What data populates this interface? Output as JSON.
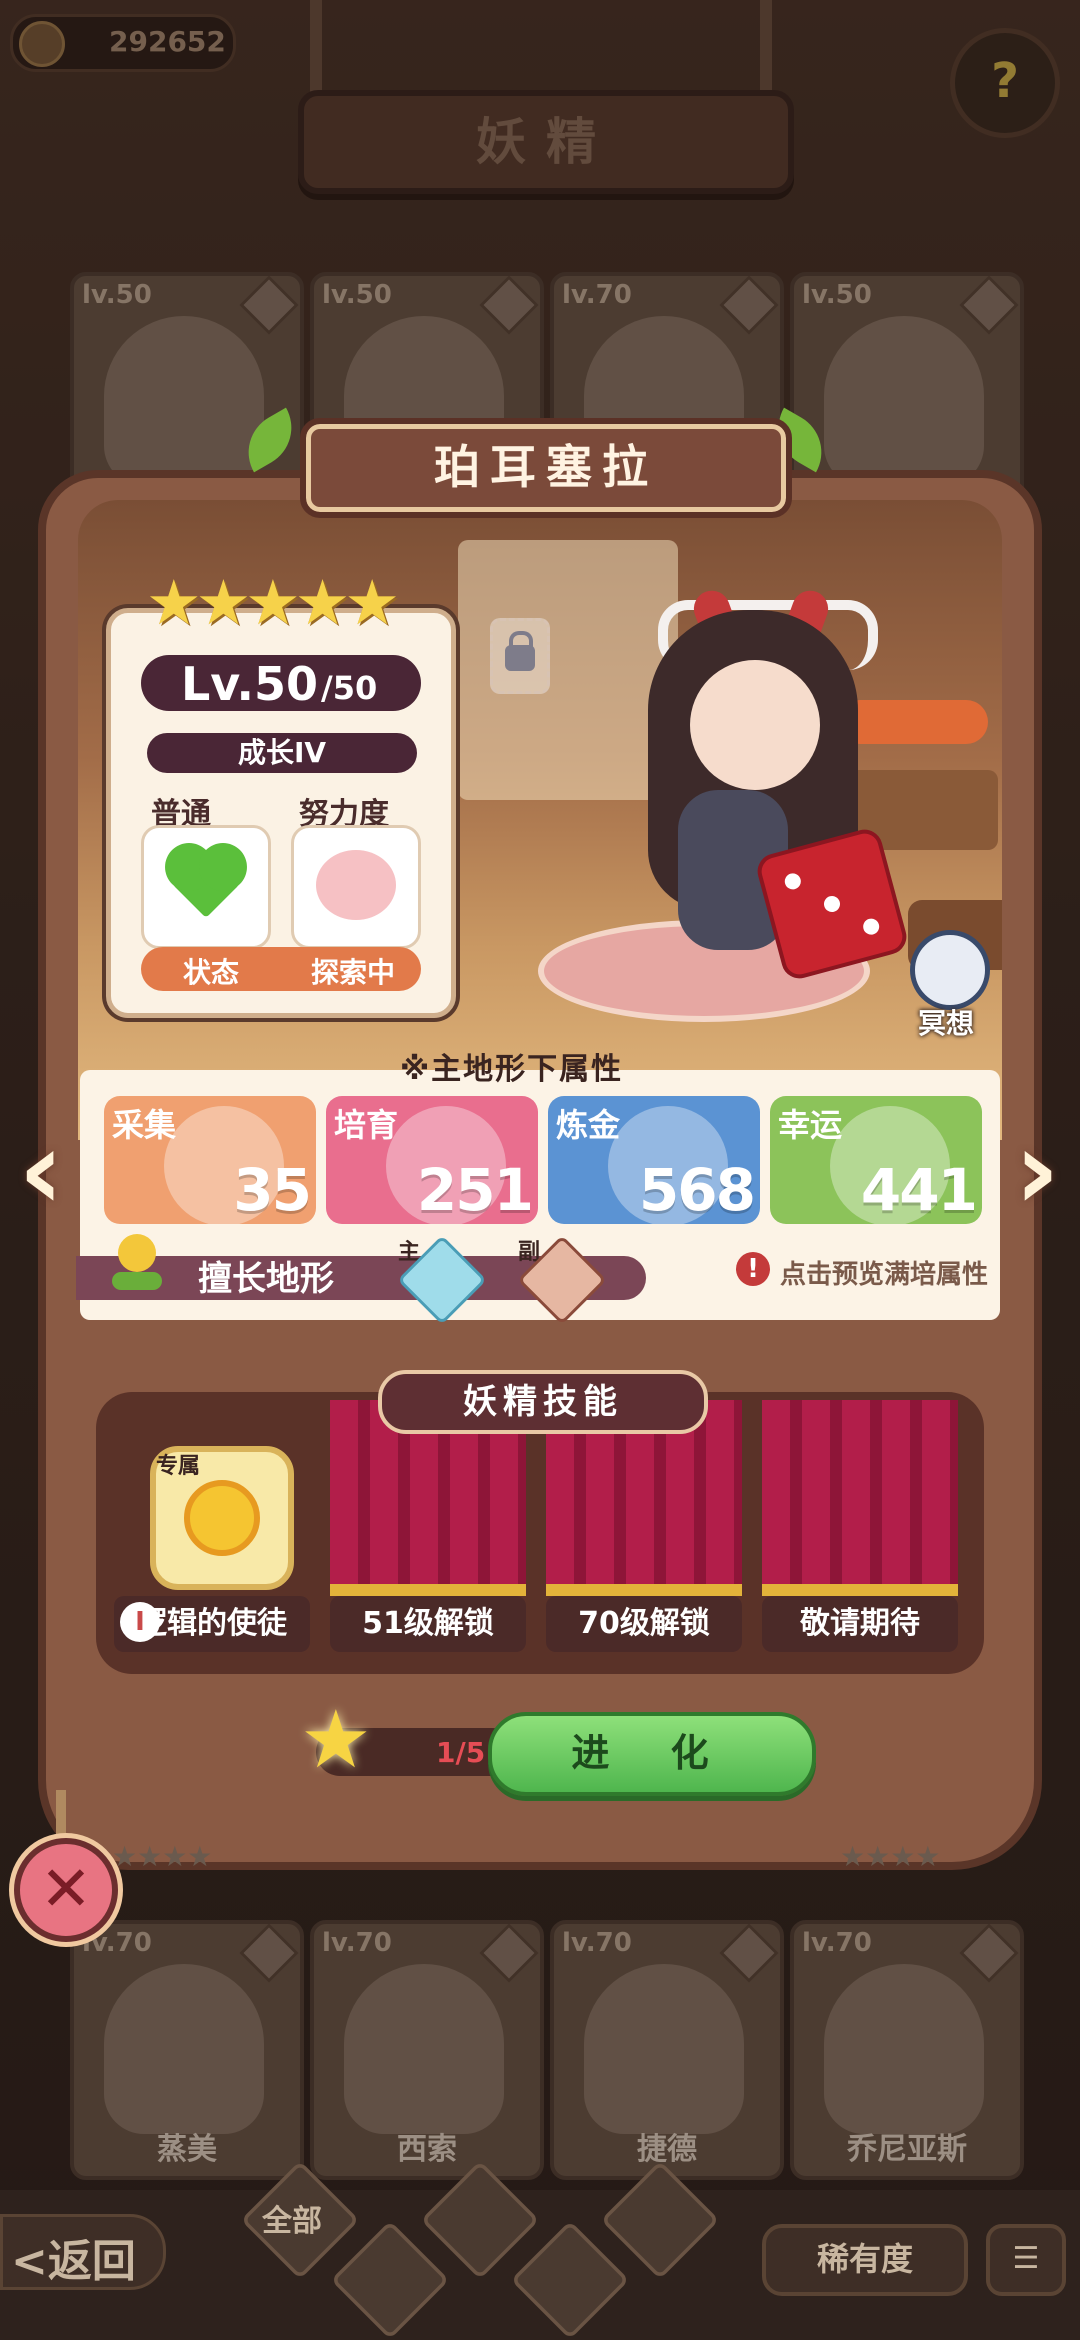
{
  "topbar": {
    "coins": "292652",
    "help_icon": "question-icon",
    "title": "妖精"
  },
  "background_cards": {
    "row1": [
      {
        "level": "lv.50",
        "element": "water"
      },
      {
        "level": "lv.50",
        "element": "earth"
      },
      {
        "level": "lv.70",
        "element": "earth"
      },
      {
        "level": "lv.50",
        "element": "water"
      }
    ],
    "row2": [
      {
        "level": "lv.70",
        "name": "蒸美"
      },
      {
        "level": "lv.70",
        "name": "西索"
      },
      {
        "level": "lv.70",
        "name": "捷德"
      },
      {
        "level": "lv.70",
        "name": "乔尼亚斯"
      }
    ]
  },
  "fairy": {
    "name": "珀耳塞拉",
    "stars": "★★★★★",
    "level": "Lv.50",
    "level_max": "/50",
    "growth": "成长IV",
    "mood_label": "普通",
    "effort_label": "努力度",
    "status_label": "状态",
    "status_value": "探索中",
    "meditate_label": "冥想"
  },
  "attributes": {
    "title": "※主地形下属性",
    "items": [
      {
        "label": "采集",
        "value": "35",
        "color": "#f0a070"
      },
      {
        "label": "培育",
        "value": "251",
        "color": "#e96e8e"
      },
      {
        "label": "炼金",
        "value": "568",
        "color": "#5b93d3"
      },
      {
        "label": "幸运",
        "value": "441",
        "color": "#8cc35a"
      }
    ],
    "terrain_label": "擅长地形",
    "terrain_main_mark": "主",
    "terrain_sub_mark": "副",
    "preview_text": "点击预览满培属性",
    "warn_symbol": "!"
  },
  "skills": {
    "title": "妖精技能",
    "exclusive_tag": "专属",
    "slots": [
      {
        "label": "逻辑的使徒"
      },
      {
        "label": "51级解锁"
      },
      {
        "label": "70级解锁"
      },
      {
        "label": "敬请期待"
      }
    ],
    "info_symbol": "I"
  },
  "evolve": {
    "progress": "1/5",
    "button_label": "进 化"
  },
  "close_symbol": "✕",
  "bottom": {
    "back_label": "<返回",
    "filter_all": "全部",
    "rarity_label": "稀有度",
    "sort_symbol": "☰"
  }
}
